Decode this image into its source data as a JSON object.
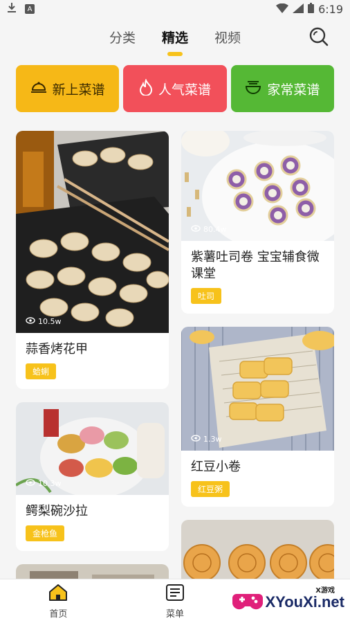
{
  "status": {
    "time": "6:19"
  },
  "tabs": [
    {
      "label": "分类"
    },
    {
      "label": "精选"
    },
    {
      "label": "视频"
    }
  ],
  "categories": [
    {
      "label": "新上菜谱",
      "icon": "cloche-icon",
      "color": "#f6b817"
    },
    {
      "label": "人气菜谱",
      "icon": "flame-icon",
      "color": "#f2505a"
    },
    {
      "label": "家常菜谱",
      "icon": "bowl-icon",
      "color": "#55b835"
    }
  ],
  "feed": {
    "left": [
      {
        "title": "蒜香烤花甲",
        "views": "10.5w",
        "tag": "蛤蜊"
      },
      {
        "title": "鳄梨碗沙拉",
        "views": "10.3w",
        "tag": "金枪鱼"
      }
    ],
    "right": [
      {
        "title": "紫薯吐司卷 宝宝辅食微课堂",
        "views": "80.4w",
        "tag": "吐司"
      },
      {
        "title": "红豆小卷",
        "views": "1.3w",
        "tag": "红豆粥"
      }
    ]
  },
  "bottom_nav": [
    {
      "label": "首页"
    },
    {
      "label": "菜单"
    }
  ],
  "watermark": {
    "main": "XYouXi.net",
    "small": "X游戏"
  },
  "colors": {
    "accent": "#f7c21b"
  }
}
